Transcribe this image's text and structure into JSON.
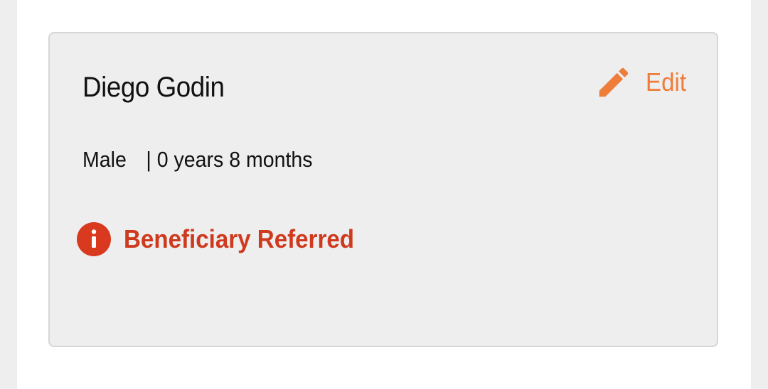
{
  "card": {
    "name": "Diego Godin",
    "edit_label": "Edit",
    "gender": "Male",
    "age": "| 0 years 8 months",
    "status_label": "Beneficiary Referred"
  },
  "icons": {
    "edit": "pencil-icon",
    "status": "info-icon"
  },
  "colors": {
    "edit_accent": "#ee7d3a",
    "status_red": "#d9391f",
    "card_background": "#eeeeee",
    "card_border": "#d6d6d6"
  }
}
